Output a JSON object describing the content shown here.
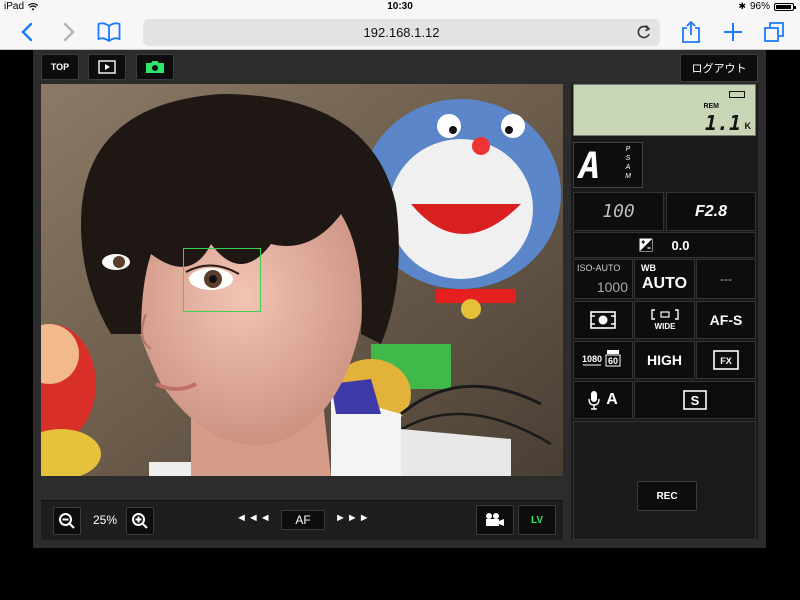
{
  "status_bar": {
    "device": "iPad",
    "time": "10:30",
    "battery": "96%",
    "battery_level": 0.96
  },
  "browser": {
    "url": "192.168.1.12"
  },
  "top_bar": {
    "top_label": "TOP",
    "logout_label": "ログアウト"
  },
  "bottom_bar": {
    "zoom": "25%",
    "af_left": "◄◄◄",
    "af_label": "AF",
    "af_right": "►►►",
    "lv_label": "LV"
  },
  "panel": {
    "lcd": {
      "rem_label": "REM",
      "count": "1.1",
      "count_unit": "K"
    },
    "mode": {
      "current": "A",
      "options": [
        "P",
        "S",
        "A",
        "M"
      ]
    },
    "shutter_speed": "100",
    "aperture": "F2.8",
    "exposure_comp": "0.0",
    "iso": {
      "label": "ISO-AUTO",
      "value": "1000"
    },
    "white_balance": {
      "label": "WB",
      "value": "AUTO"
    },
    "picture_control": "---",
    "af_mode": "AF-S",
    "af_area": "WIDE",
    "movie_size": {
      "resolution": "1080",
      "fps": "60"
    },
    "quality": "HIGH",
    "fx_label": "FX",
    "mic_label": "A",
    "s_label": "S",
    "rec_label": "REC"
  },
  "colors": {
    "accent_green": "#2ee66b",
    "ios_blue": "#1a7bff",
    "af_frame": "#39d353"
  }
}
